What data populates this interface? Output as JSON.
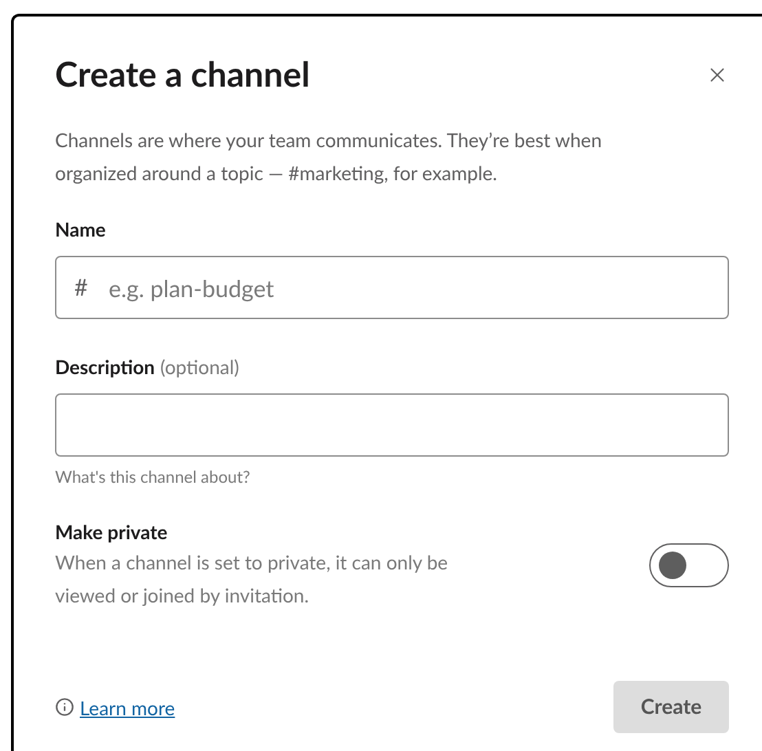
{
  "dialog": {
    "title": "Create a channel",
    "intro": "Channels are where your team communicates. They’re best when organized around a topic — #marketing, for example.",
    "name_field": {
      "label": "Name",
      "prefix": "#",
      "placeholder": "e.g. plan-budget"
    },
    "description_field": {
      "label": "Description",
      "label_note": "(optional)",
      "hint": "What's this channel about?"
    },
    "private": {
      "label": "Make private",
      "description": "When a channel is set to private, it can only be viewed or joined by invitation.",
      "on": false
    },
    "learn_more": "Learn more",
    "create_button": {
      "label": "Create",
      "disabled": true
    }
  }
}
